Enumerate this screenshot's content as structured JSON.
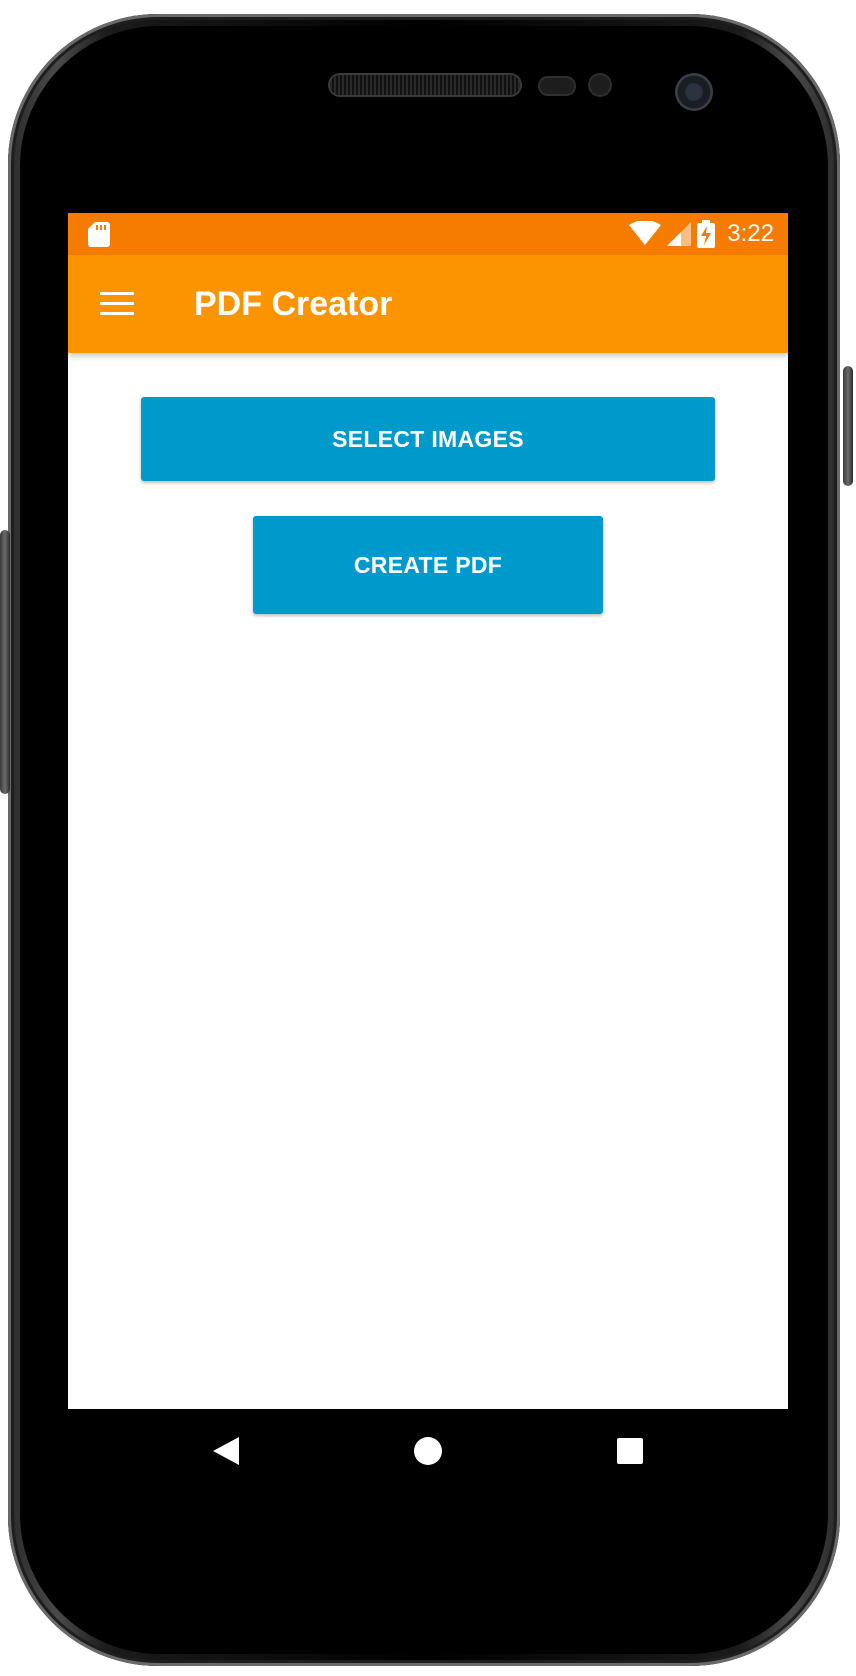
{
  "status_bar": {
    "time": "3:22",
    "color": "#f57c00",
    "icons": [
      "sd-card-icon",
      "wifi-icon",
      "cell-signal-icon",
      "battery-charging-icon"
    ]
  },
  "app_bar": {
    "title": "PDF Creator",
    "color": "#fb9400",
    "menu_icon": "hamburger-menu-icon"
  },
  "main": {
    "select_images_label": "SELECT IMAGES",
    "create_pdf_label": "CREATE PDF",
    "button_color": "#0099cc"
  },
  "nav_bar": {
    "items": [
      "back-icon",
      "home-icon",
      "recents-icon"
    ]
  }
}
